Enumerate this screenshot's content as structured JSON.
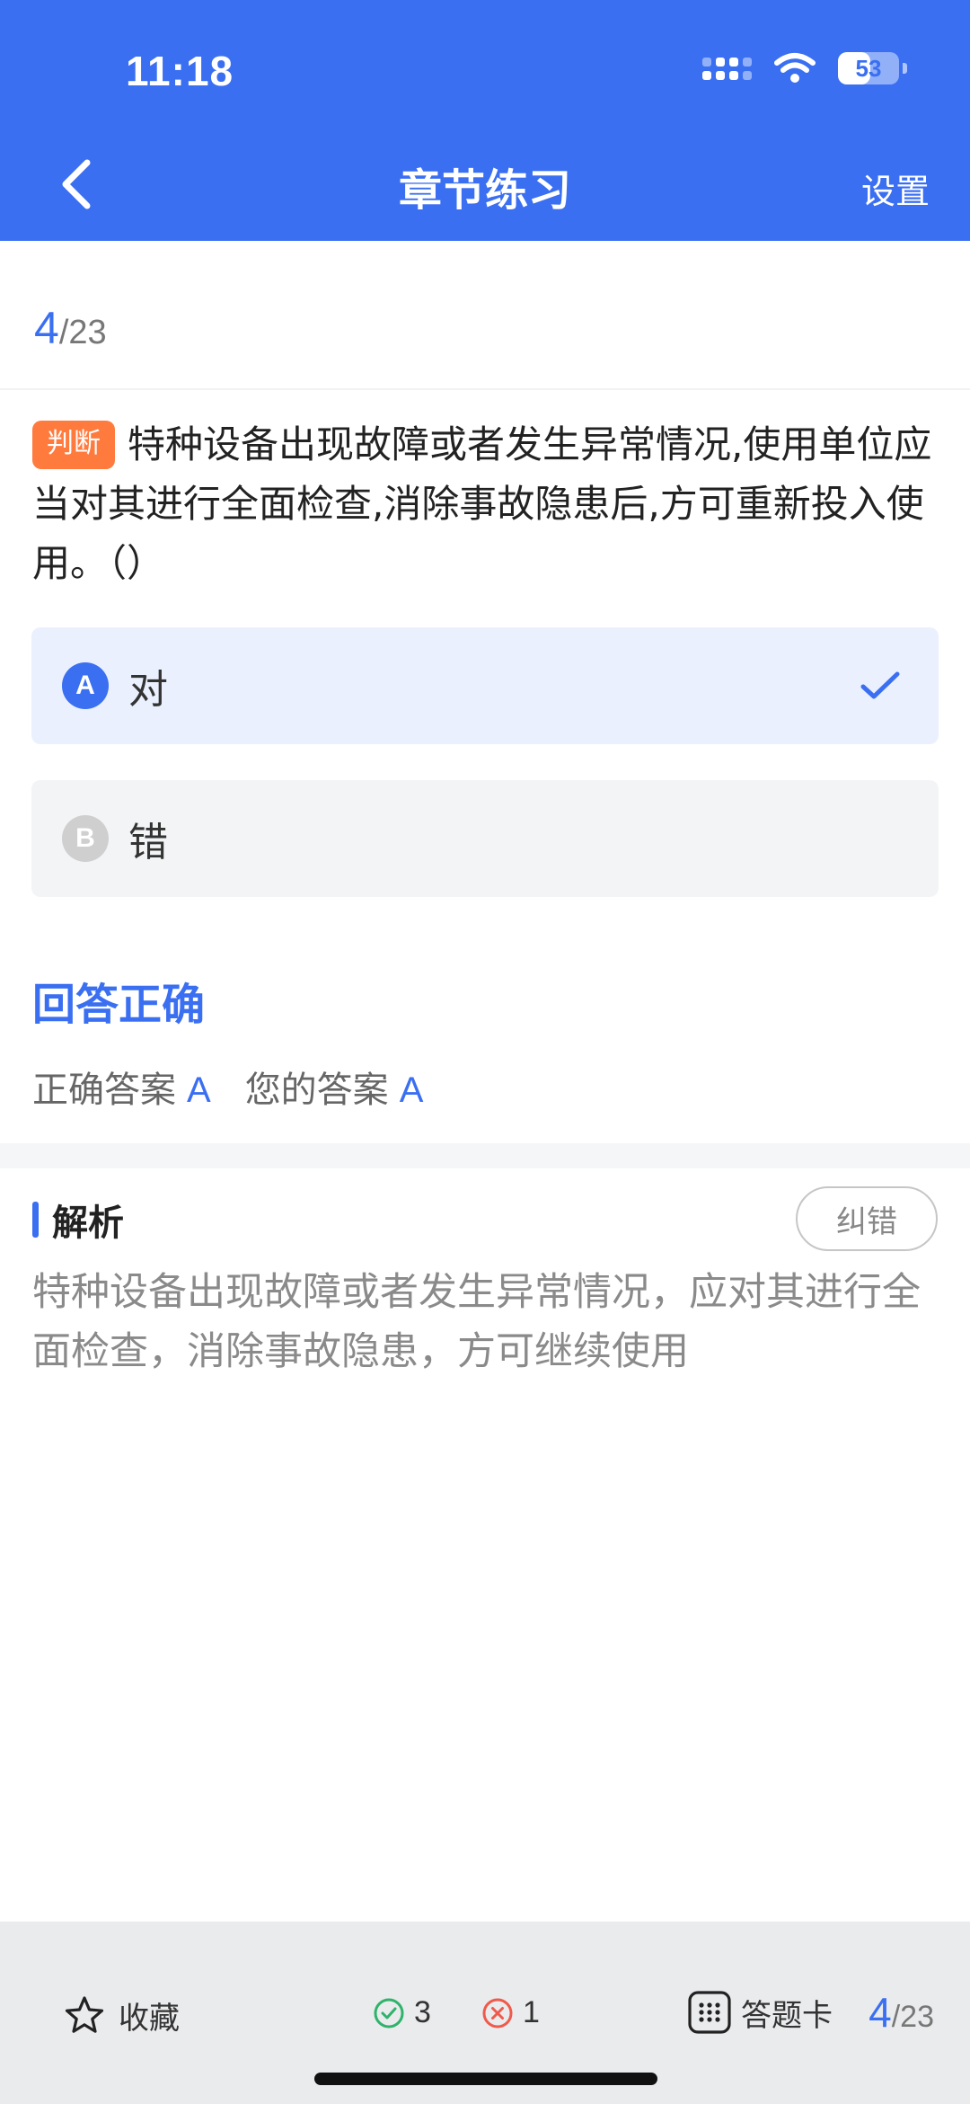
{
  "status_bar": {
    "time": "11:18",
    "battery": "53",
    "battery_level": 0.53
  },
  "header": {
    "title": "章节练习",
    "settings_label": "设置"
  },
  "progress": {
    "current": "4",
    "total": "/23"
  },
  "question": {
    "tag": "判断",
    "text": "特种设备出现故障或者发生异常情况,使用单位应当对其进行全面检查,消除事故隐患后,方可重新投入使用。（）"
  },
  "options": [
    {
      "letter": "A",
      "text": "对",
      "selected": true
    },
    {
      "letter": "B",
      "text": "错",
      "selected": false
    }
  ],
  "result": {
    "title": "回答正确",
    "correct_label": "正确答案",
    "correct_value": "A",
    "yours_label": "您的答案",
    "yours_value": "A"
  },
  "analysis": {
    "title": "解析",
    "report_label": "纠错",
    "text": "特种设备出现故障或者发生异常情况，应对其进行全面检查，消除事故隐患，方可继续使用"
  },
  "bottom_bar": {
    "favorite_label": "收藏",
    "correct_count": "3",
    "wrong_count": "1",
    "card_label": "答题卡",
    "progress_current": "4",
    "progress_total": "/23"
  },
  "colors": {
    "accent": "#3a6ff2",
    "tag": "#ff7a3d",
    "correct": "#2fb36b",
    "wrong": "#f05a4a"
  }
}
